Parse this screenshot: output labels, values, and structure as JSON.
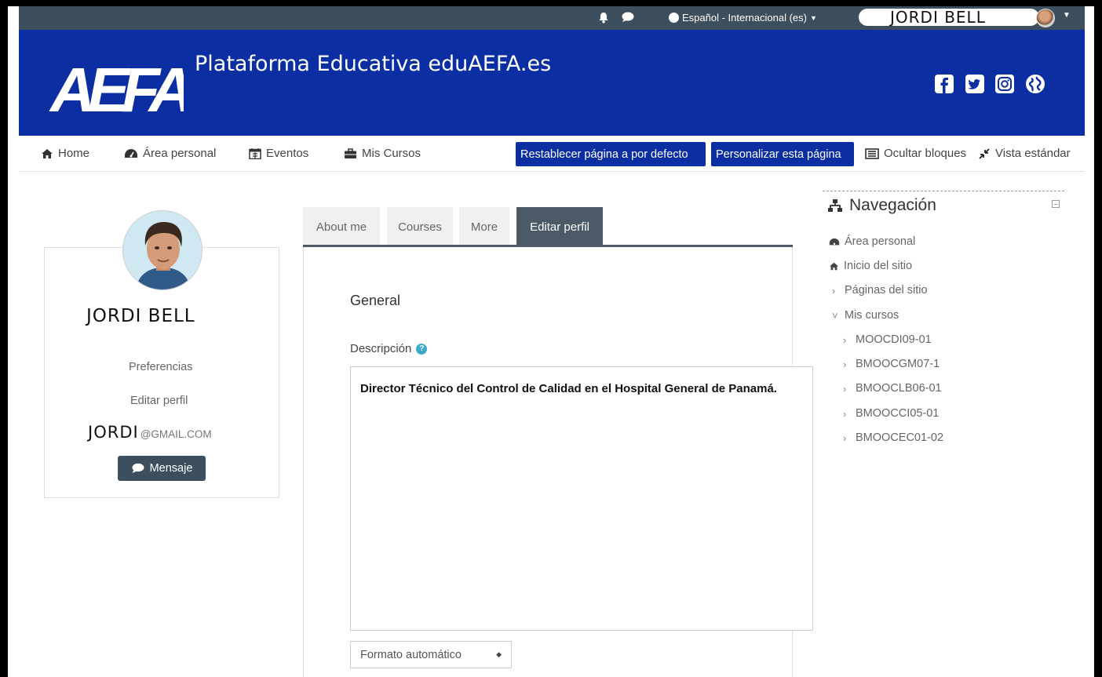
{
  "topbar": {
    "language": "Español - Internacional (es)",
    "user_name": "JORDI BELL"
  },
  "header": {
    "logo_text": "AEFA",
    "site_title": "Plataforma Educativa eduAEFA.es",
    "social_icons": [
      "facebook-icon",
      "twitter-icon",
      "instagram-icon",
      "globe-icon"
    ],
    "brand_color": "#0b2fa3"
  },
  "navbar": {
    "home": "Home",
    "area_personal": "Área personal",
    "eventos": "Eventos",
    "mis_cursos": "Mis Cursos",
    "reset_button": "Restablecer página a por defecto",
    "customize_button": "Personalizar esta página",
    "hide_blocks": "Ocultar bloques",
    "standard_view": "Vista estándar"
  },
  "profile": {
    "name": "JORDI BELL",
    "preferences_link": "Preferencias",
    "edit_profile_link": "Editar perfil",
    "email_name": "JORDI",
    "email_domain": "@GMAIL.COM",
    "message_button": "Mensaje"
  },
  "tabs": [
    {
      "label": "About me",
      "active": false
    },
    {
      "label": "Courses",
      "active": false
    },
    {
      "label": "More",
      "active": false
    },
    {
      "label": "Editar perfil",
      "active": true
    }
  ],
  "edit_form": {
    "section_title": "General",
    "description_label": "Descripción",
    "description_text": "Director Técnico del Control de Calidad en el Hospital General de Panamá.",
    "format_select_value": "Formato automático"
  },
  "navigation": {
    "title": "Navegación",
    "items": [
      {
        "label": "Área personal"
      },
      {
        "label": "Inicio del sitio"
      },
      {
        "label": "Páginas del sitio"
      },
      {
        "label": "Mis cursos"
      },
      {
        "label": "MOOCDI09-01"
      },
      {
        "label": "BMOOCGM07-1"
      },
      {
        "label": "BMOOCLB06-01"
      },
      {
        "label": "BMOOCCI05-01"
      },
      {
        "label": "BMOOCEC01-02"
      }
    ]
  }
}
